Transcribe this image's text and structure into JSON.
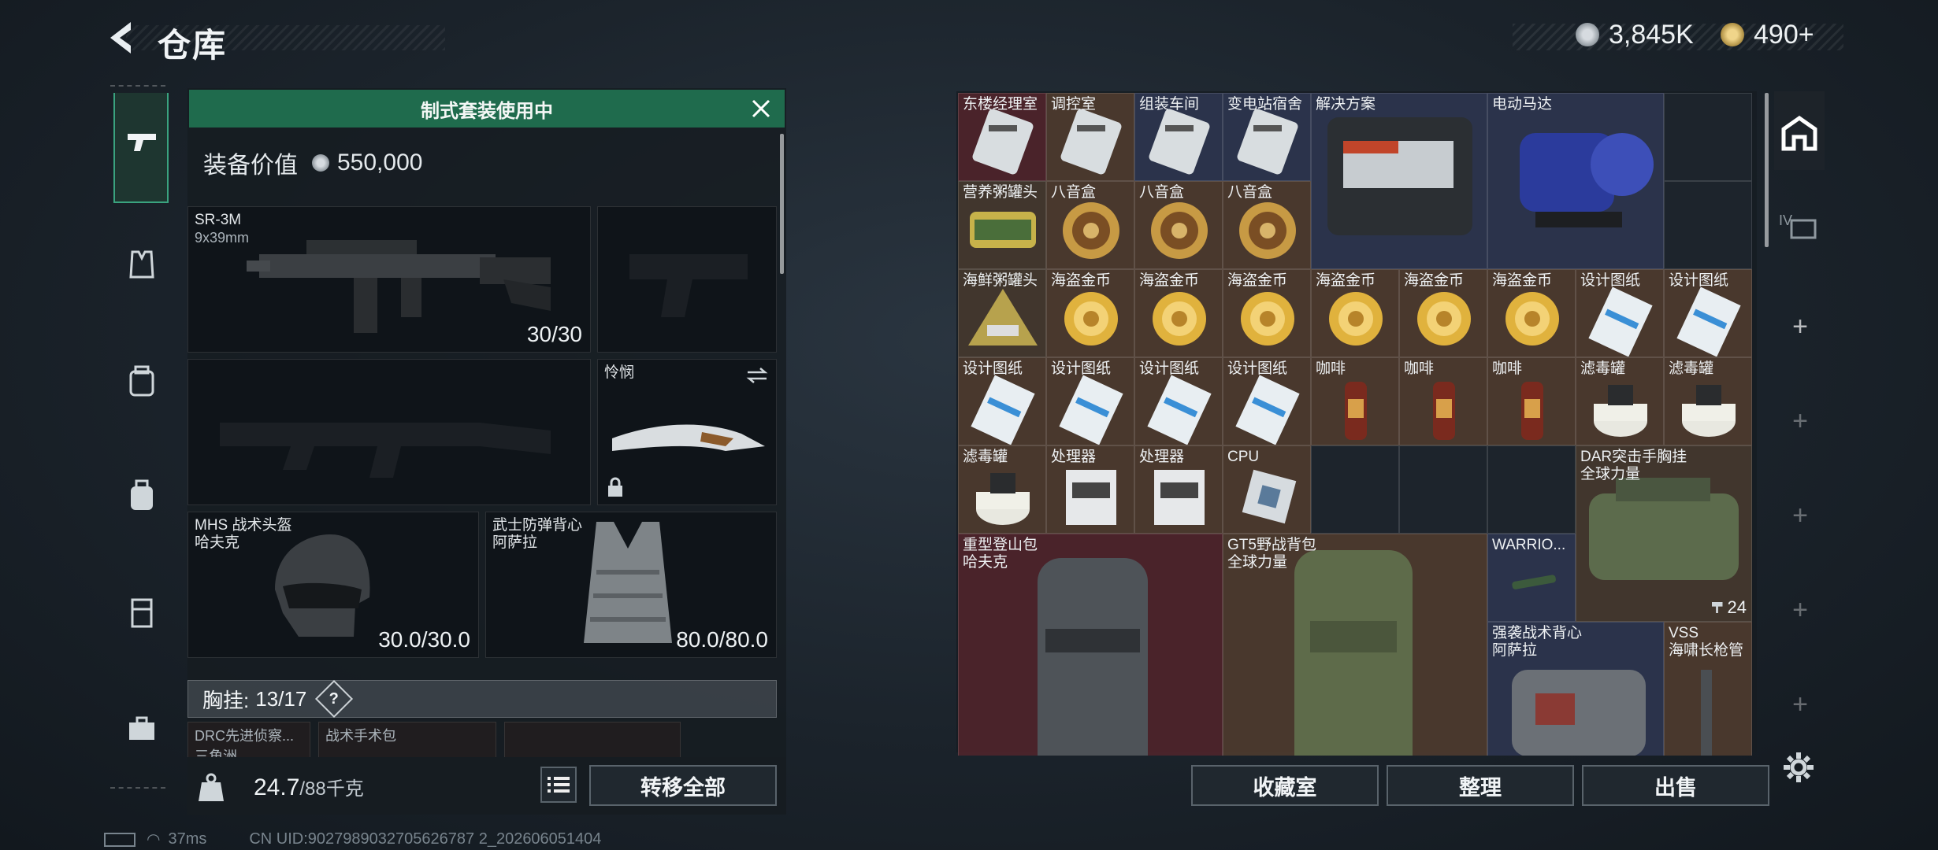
{
  "header": {
    "title": "仓库",
    "currency": [
      {
        "icon": "silver-coin-icon",
        "value": "3,845K"
      },
      {
        "icon": "gold-coin-icon",
        "value": "490+"
      }
    ]
  },
  "left_rail": [
    {
      "icon": "pistol-icon",
      "active": true
    },
    {
      "icon": "vest-icon",
      "active": false
    },
    {
      "icon": "backpack-outline-icon",
      "active": false
    },
    {
      "icon": "backpack-icon",
      "active": false
    },
    {
      "icon": "locker-icon",
      "active": false
    },
    {
      "icon": "briefcase-icon",
      "active": false
    }
  ],
  "loadout": {
    "banner": "制式套装使用中",
    "gear_value_label": "装备价值",
    "gear_value": "550,000",
    "primary": {
      "name": "SR-3M",
      "caliber": "9x39mm",
      "ammo": "30/30"
    },
    "melee": {
      "name": "怜悯"
    },
    "helmet": {
      "name": "MHS 战术头盔",
      "maker": "哈夫克",
      "durability": "30.0/30.0"
    },
    "armor": {
      "name": "武士防弹背心",
      "maker": "阿萨拉",
      "durability": "80.0/80.0"
    },
    "chest_rig": {
      "label": "胸挂:",
      "capacity": "13/17",
      "hint": "?"
    },
    "mini_slots": [
      "DRC先进侦察...",
      "战术手术包"
    ],
    "mini_slot_sub": "三角洲",
    "weight": "24.7",
    "weight_max": "/88千克",
    "transfer_all": "转移全部"
  },
  "stash": {
    "cells": [
      {
        "name": "东楼经理室",
        "color": "#56242c"
      },
      {
        "name": "调控室"
      },
      {
        "name": "组装车间"
      },
      {
        "name": "变电站宿舍"
      },
      {
        "name": "解决方案"
      },
      {
        "name": "电动马达"
      },
      {
        "name": "营养粥罐头"
      },
      {
        "name": "八音盒"
      },
      {
        "name": "八音盒"
      },
      {
        "name": "八音盒"
      },
      {
        "name": "海鲜粥罐头"
      },
      {
        "name": "海盗金币"
      },
      {
        "name": "海盗金币"
      },
      {
        "name": "海盗金币"
      },
      {
        "name": "海盗金币"
      },
      {
        "name": "海盗金币"
      },
      {
        "name": "海盗金币"
      },
      {
        "name": "设计图纸"
      },
      {
        "name": "设计图纸"
      },
      {
        "name": "设计图纸"
      },
      {
        "name": "设计图纸"
      },
      {
        "name": "设计图纸"
      },
      {
        "name": "设计图纸"
      },
      {
        "name": "咖啡"
      },
      {
        "name": "咖啡"
      },
      {
        "name": "咖啡"
      },
      {
        "name": "滤毒罐"
      },
      {
        "name": "滤毒罐"
      },
      {
        "name": "滤毒罐"
      },
      {
        "name": "处理器"
      },
      {
        "name": "处理器"
      },
      {
        "name": "CPU"
      },
      {
        "name": "DAR突击手胸挂",
        "maker": "全球力量",
        "stack": "24"
      },
      {
        "name": "重型登山包",
        "maker": "哈夫克"
      },
      {
        "name": "GT5野战背包",
        "maker": "全球力量"
      },
      {
        "name": "WARRIO..."
      },
      {
        "name": "强袭战术背心",
        "maker": "阿萨拉"
      },
      {
        "name": "VSS",
        "maker": "海啸长枪管"
      }
    ],
    "buttons": {
      "collection": "收藏室",
      "sort": "整理",
      "sell": "出售"
    }
  },
  "footer": {
    "ping": "37ms",
    "uid": "CN UID:9027989032705626787 2_202606051404"
  }
}
